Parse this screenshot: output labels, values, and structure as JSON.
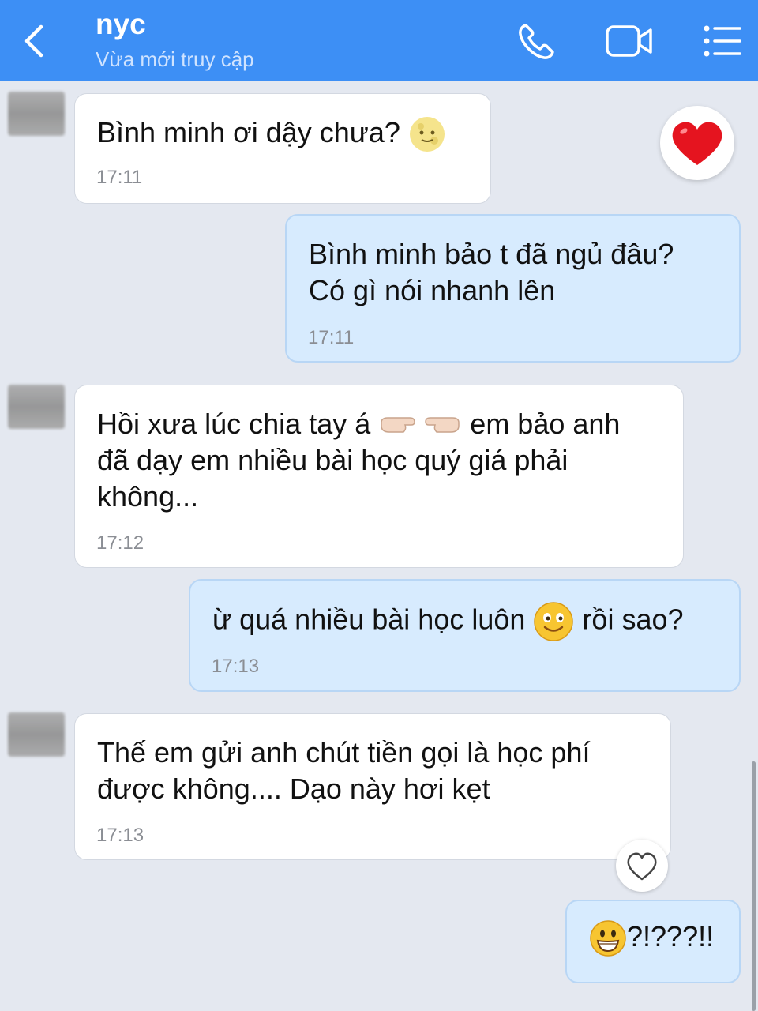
{
  "header": {
    "title": "nyc",
    "status": "Vừa mới truy cập",
    "back_icon": "chevron-left-icon",
    "call_icon": "phone-icon",
    "video_icon": "video-camera-icon",
    "menu_icon": "list-menu-icon",
    "color": "#3d8ff5"
  },
  "messages": [
    {
      "dir": "in",
      "text": "Bình minh ơi dậy chưa?",
      "emoji": "moon-face-icon",
      "time": "17:11",
      "reaction": "heart-icon"
    },
    {
      "dir": "out",
      "line1": "Bình minh bảo t đã ngủ đâu?",
      "line2": "Có gì nói nhanh lên",
      "time": "17:11"
    },
    {
      "dir": "in",
      "pre": "Hồi xưa lúc chia tay á",
      "emoji": "pointing-hands-icon",
      "post": "em bảo anh",
      "line2": "đã dạy em nhiều bài học quý giá phải",
      "line3": "không...",
      "time": "17:12"
    },
    {
      "dir": "out",
      "pre": "ừ quá nhiều bài học luôn",
      "emoji": "smiling-face-icon",
      "post": "rồi sao?",
      "time": "17:13"
    },
    {
      "dir": "in",
      "line1": "Thế em gửi anh chút tiền gọi là học phí",
      "line2": "được không.... Dạo này hơi kẹt",
      "time": "17:13",
      "reaction": "heart-outline-icon"
    },
    {
      "dir": "out",
      "emoji": "grinning-face-icon",
      "text": "?!???!!"
    }
  ],
  "colors": {
    "background": "#e4e8f0",
    "incoming_bubble": "#ffffff",
    "outgoing_bubble": "#d7ebfe"
  }
}
